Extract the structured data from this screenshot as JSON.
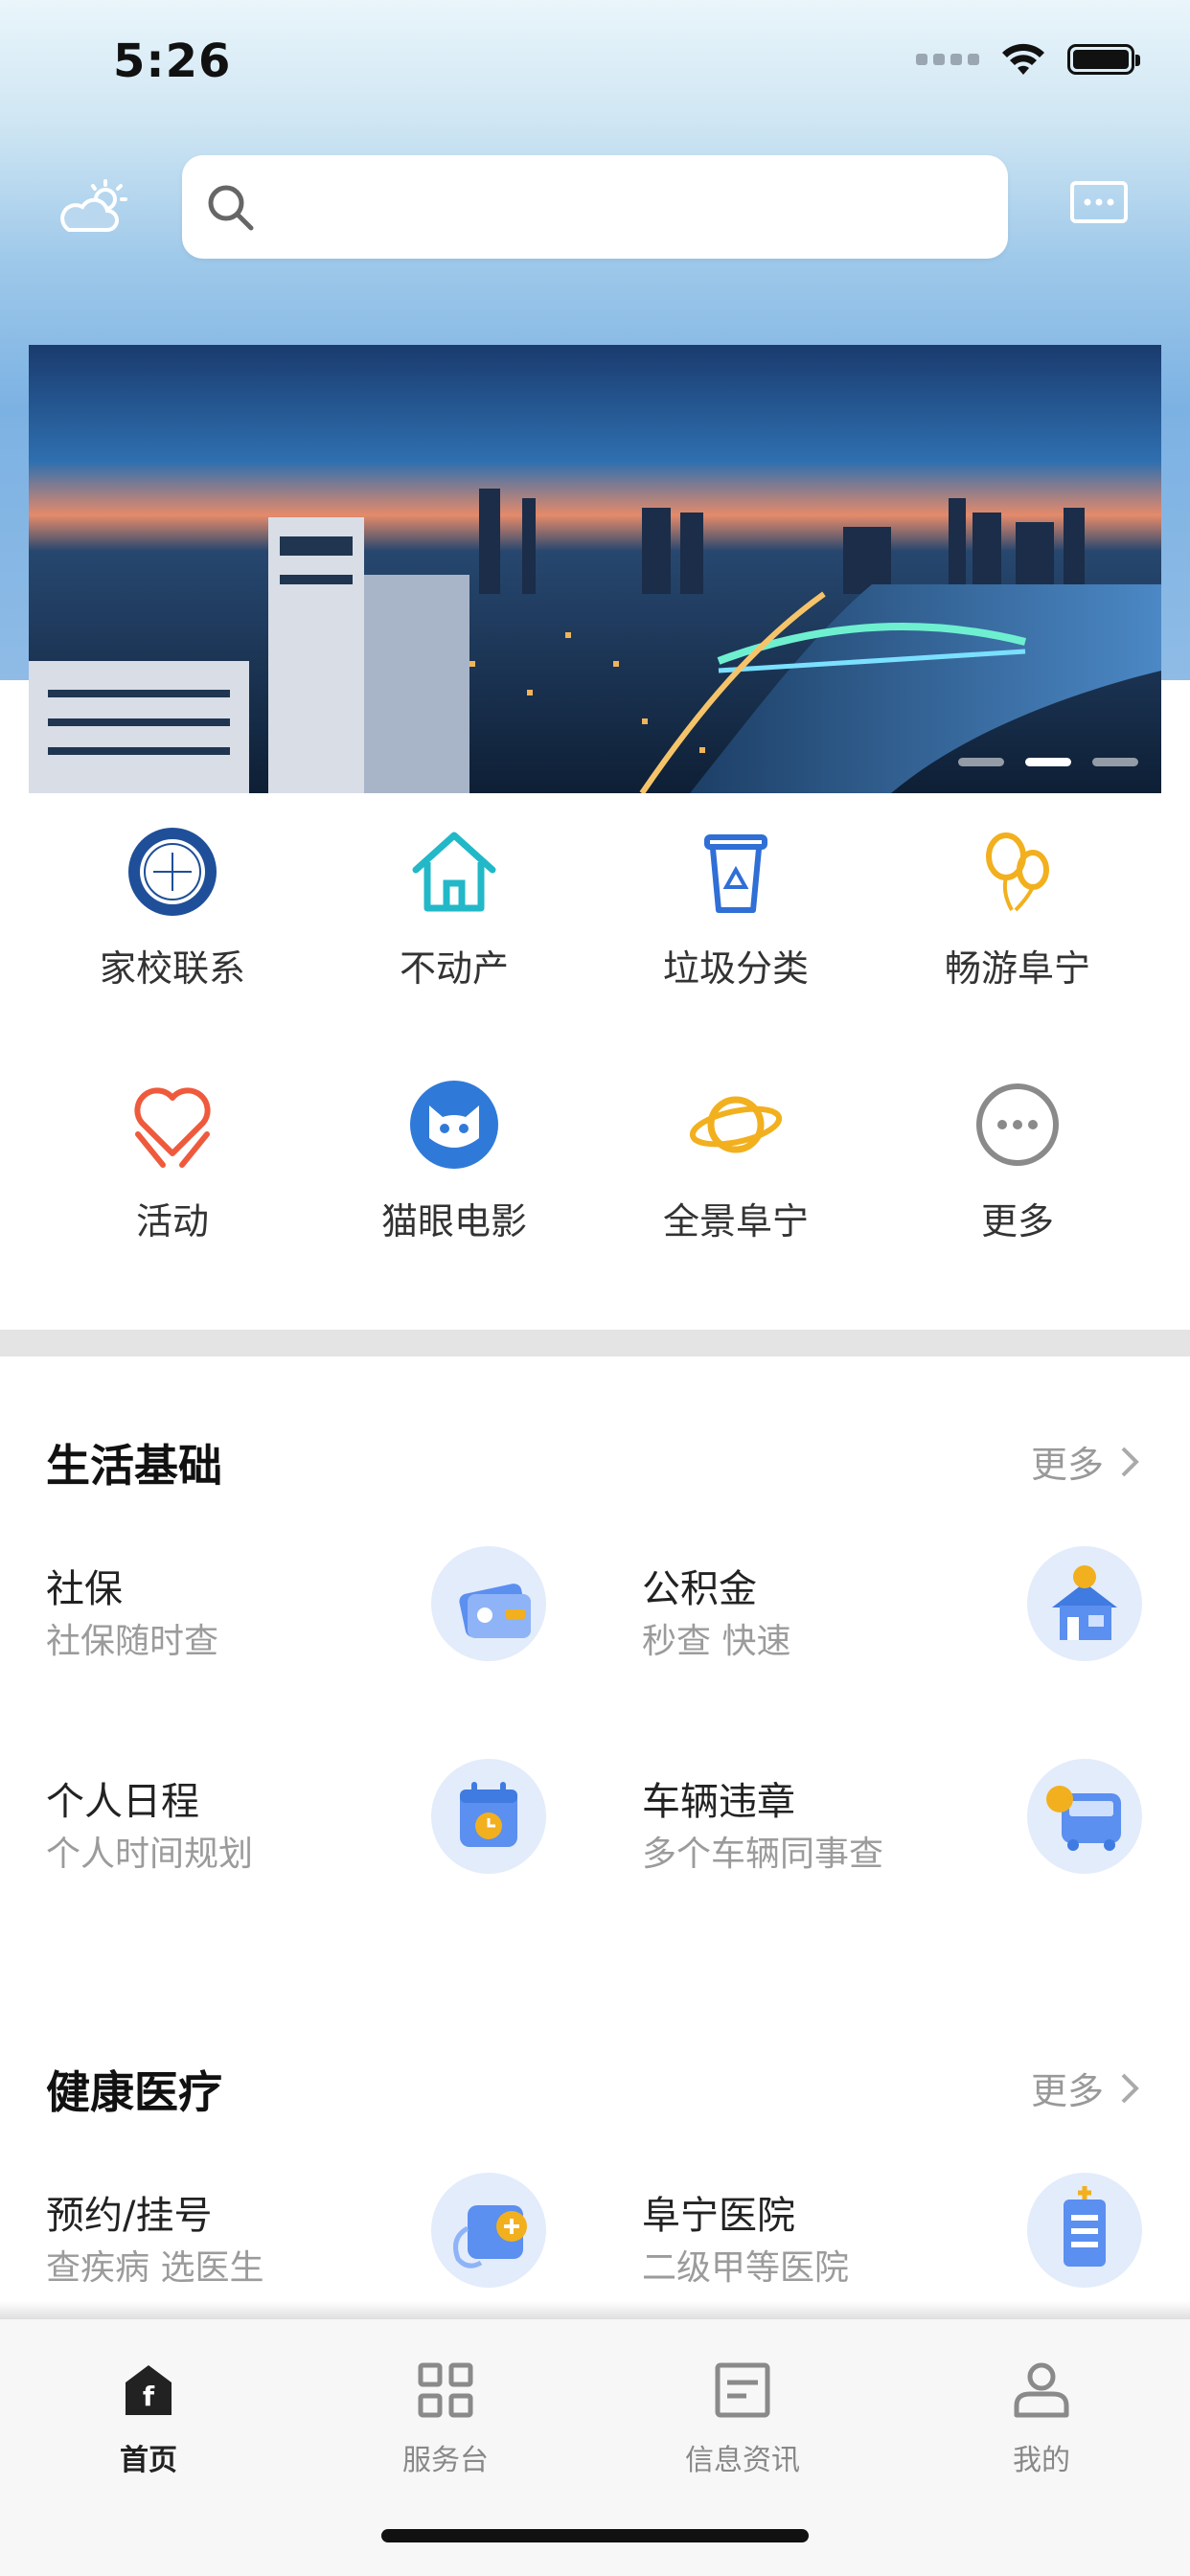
{
  "status_bar": {
    "time": "5:26"
  },
  "header": {
    "weather_icon": "partly-cloudy-icon",
    "search": {
      "placeholder": "",
      "icon": "search-icon"
    },
    "message_icon": "message-icon"
  },
  "banner": {
    "dots_total": 3,
    "active_dot": 2
  },
  "quick_access": [
    {
      "label": "家校联系",
      "icon": "school-emblem-icon",
      "color": "#1f4f99"
    },
    {
      "label": "不动产",
      "icon": "house-icon",
      "color": "#22b8c8"
    },
    {
      "label": "垃圾分类",
      "icon": "recycle-bin-icon",
      "color": "#2f6fd6"
    },
    {
      "label": "畅游阜宁",
      "icon": "balloons-icon",
      "color": "#f2b01e"
    },
    {
      "label": "活动",
      "icon": "heart-hands-icon",
      "color": "#ef5a3c"
    },
    {
      "label": "猫眼电影",
      "icon": "cat-eye-icon",
      "color": "#2f7ad9"
    },
    {
      "label": "全景阜宁",
      "icon": "planet-icon",
      "color": "#f2b01e"
    },
    {
      "label": "更多",
      "icon": "more-dots-icon",
      "color": "#8a8a8a"
    }
  ],
  "sections": {
    "life": {
      "title": "生活基础",
      "more": "更多",
      "cards": [
        {
          "title": "社保",
          "subtitle": "社保随时查",
          "icon": "social-security-card-icon"
        },
        {
          "title": "公积金",
          "subtitle": "秒查 快速",
          "icon": "housing-fund-icon"
        },
        {
          "title": "个人日程",
          "subtitle": "个人时间规划",
          "icon": "calendar-clock-icon"
        },
        {
          "title": "车辆违章",
          "subtitle": "多个车辆同事查",
          "icon": "bus-violation-icon"
        }
      ]
    },
    "health": {
      "title": "健康医疗",
      "more": "更多",
      "cards": [
        {
          "title": "预约/挂号",
          "subtitle": "查疾病 选医生",
          "icon": "medical-kit-icon"
        },
        {
          "title": "阜宁医院",
          "subtitle": "二级甲等医院",
          "icon": "hospital-icon"
        }
      ]
    }
  },
  "tabbar": [
    {
      "label": "首页",
      "icon": "home-icon",
      "active": true
    },
    {
      "label": "服务台",
      "icon": "grid-icon",
      "active": false
    },
    {
      "label": "信息资讯",
      "icon": "news-icon",
      "active": false
    },
    {
      "label": "我的",
      "icon": "profile-icon",
      "active": false
    }
  ],
  "colors": {
    "accent_blue": "#4a8fe8",
    "text_secondary": "#9b9b9b"
  }
}
